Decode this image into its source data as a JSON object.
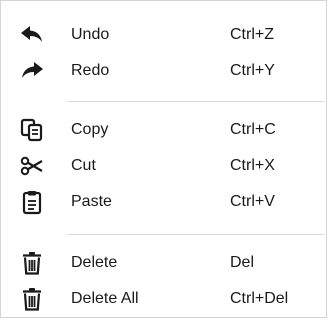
{
  "menu": {
    "items": [
      {
        "label": "Undo",
        "shortcut": "Ctrl+Z",
        "icon": "undo-icon"
      },
      {
        "label": "Redo",
        "shortcut": "Ctrl+Y",
        "icon": "redo-icon"
      },
      {
        "label": "Copy",
        "shortcut": "Ctrl+C",
        "icon": "copy-icon"
      },
      {
        "label": "Cut",
        "shortcut": "Ctrl+X",
        "icon": "scissors-icon"
      },
      {
        "label": "Paste",
        "shortcut": "Ctrl+V",
        "icon": "clipboard-icon"
      },
      {
        "label": "Delete",
        "shortcut": "Del",
        "icon": "trash-icon"
      },
      {
        "label": "Delete All",
        "shortcut": "Ctrl+Del",
        "icon": "trash-icon"
      }
    ]
  }
}
